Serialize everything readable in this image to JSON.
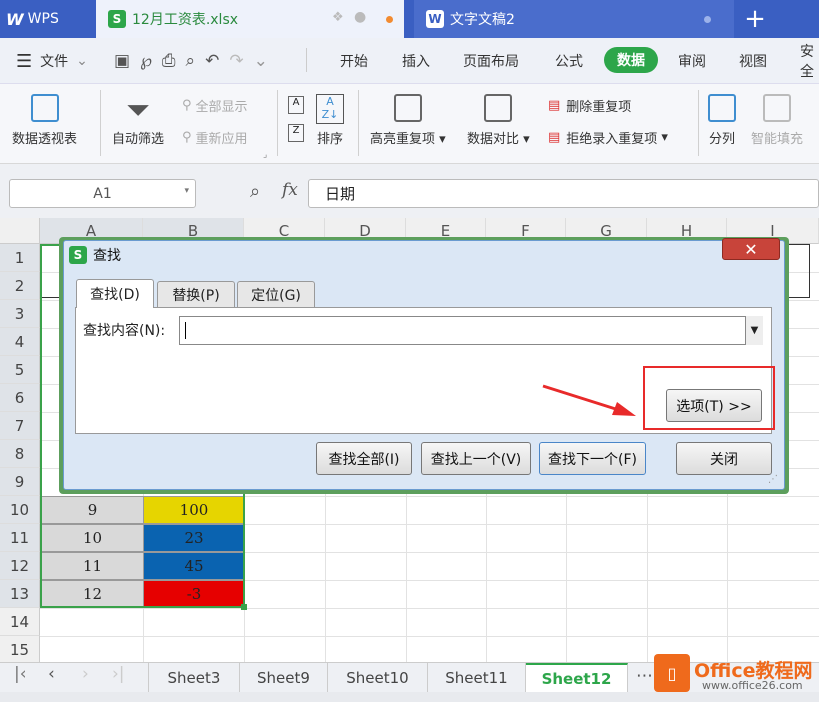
{
  "tabs": {
    "app": "WPS",
    "xlsx": {
      "label": "12月工资表.xlsx",
      "icon": "S"
    },
    "doc": {
      "label": "文字文稿2",
      "icon": "W"
    },
    "new_tab": "+"
  },
  "menu": {
    "file": "文件",
    "items": [
      "开始",
      "插入",
      "页面布局",
      "公式",
      "数据",
      "审阅",
      "视图",
      "安全"
    ]
  },
  "ribbon": {
    "pivot": "数据透视表",
    "autofilter": "自动筛选",
    "show_all": "全部显示",
    "reapply": "重新应用",
    "sort": "排序",
    "highlight_dup": "高亮重复项",
    "compare": "数据对比",
    "delete_dup": "删除重复项",
    "reject_dup": "拒绝录入重复项",
    "split": "分列",
    "smart_fill": "智能填充"
  },
  "formula_bar": {
    "cell_ref": "A1",
    "fx": "fx",
    "content": "日期"
  },
  "columns": [
    "A",
    "B",
    "C",
    "D",
    "E",
    "F",
    "G",
    "H",
    "I"
  ],
  "rows": [
    "1",
    "2",
    "3",
    "4",
    "5",
    "6",
    "7",
    "8",
    "9",
    "10",
    "11",
    "12",
    "13",
    "14",
    "15"
  ],
  "data_rows": [
    {
      "a": "9",
      "b": "100",
      "color": "#e6d500"
    },
    {
      "a": "10",
      "b": "23",
      "color": "#0a63b0"
    },
    {
      "a": "11",
      "b": "45",
      "color": "#0a63b0"
    },
    {
      "a": "12",
      "b": "-3",
      "color": "#e60000"
    }
  ],
  "sheets": [
    "Sheet3",
    "Sheet9",
    "Sheet10",
    "Sheet11",
    "Sheet12"
  ],
  "active_sheet": "Sheet12",
  "dialog": {
    "title": "查找",
    "tabs": [
      "查找(D)",
      "替换(P)",
      "定位(G)"
    ],
    "find_label": "查找内容(N):",
    "find_value": "",
    "options_button": "选项(T) >>",
    "find_all": "查找全部(I)",
    "find_prev": "查找上一个(V)",
    "find_next": "查找下一个(F)",
    "close": "关闭"
  },
  "watermark": {
    "brand": "Office教程网",
    "url": "www.office26.com"
  }
}
